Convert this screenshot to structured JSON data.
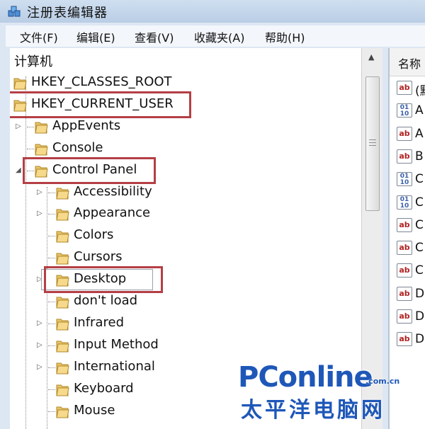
{
  "window": {
    "title": "注册表编辑器"
  },
  "menu": [
    "文件(F)",
    "编辑(E)",
    "查看(V)",
    "收藏夹(A)",
    "帮助(H)"
  ],
  "tree": {
    "root": "计算机",
    "nodes": [
      {
        "label": "HKEY_CLASSES_ROOT",
        "level": 1,
        "expander": "none",
        "highlighted": false
      },
      {
        "label": "HKEY_CURRENT_USER",
        "level": 1,
        "expander": "none",
        "highlighted": true
      },
      {
        "label": "AppEvents",
        "level": 2,
        "expander": "collapsed",
        "highlighted": false
      },
      {
        "label": "Console",
        "level": 2,
        "expander": "none",
        "highlighted": false
      },
      {
        "label": "Control Panel",
        "level": 2,
        "expander": "expanded",
        "highlighted": true
      },
      {
        "label": "Accessibility",
        "level": 3,
        "expander": "collapsed",
        "highlighted": false
      },
      {
        "label": "Appearance",
        "level": 3,
        "expander": "collapsed",
        "highlighted": false
      },
      {
        "label": "Colors",
        "level": 3,
        "expander": "none",
        "highlighted": false
      },
      {
        "label": "Cursors",
        "level": 3,
        "expander": "none",
        "highlighted": false
      },
      {
        "label": "Desktop",
        "level": 3,
        "expander": "collapsed",
        "highlighted": true,
        "selected": true
      },
      {
        "label": "don't load",
        "level": 3,
        "expander": "none",
        "highlighted": false
      },
      {
        "label": "Infrared",
        "level": 3,
        "expander": "collapsed",
        "highlighted": false
      },
      {
        "label": "Input Method",
        "level": 3,
        "expander": "collapsed",
        "highlighted": false
      },
      {
        "label": "International",
        "level": 3,
        "expander": "collapsed",
        "highlighted": false
      },
      {
        "label": "Keyboard",
        "level": 3,
        "expander": "none",
        "highlighted": false
      },
      {
        "label": "Mouse",
        "level": 3,
        "expander": "none",
        "highlighted": false
      }
    ]
  },
  "values_pane": {
    "column_header": "名称",
    "rows": [
      {
        "icon": "string-value-icon",
        "name": "(默"
      },
      {
        "icon": "binary-value-icon",
        "name": "A"
      },
      {
        "icon": "string-value-icon",
        "name": "A"
      },
      {
        "icon": "string-value-icon",
        "name": "B"
      },
      {
        "icon": "binary-value-icon",
        "name": "C"
      },
      {
        "icon": "binary-value-icon",
        "name": "C"
      },
      {
        "icon": "string-value-icon",
        "name": "C"
      },
      {
        "icon": "string-value-icon",
        "name": "C"
      },
      {
        "icon": "string-value-icon",
        "name": "C"
      },
      {
        "icon": "string-value-icon",
        "name": "D"
      },
      {
        "icon": "string-value-icon",
        "name": "D"
      },
      {
        "icon": "string-value-icon",
        "name": "D"
      }
    ]
  },
  "watermark": {
    "brand": "PConline",
    "domain": ".com.cn",
    "cn_name": "太平洋电脑网"
  },
  "colors": {
    "highlight_box": "#b43f45",
    "watermark_blue": "#1e57b8"
  }
}
